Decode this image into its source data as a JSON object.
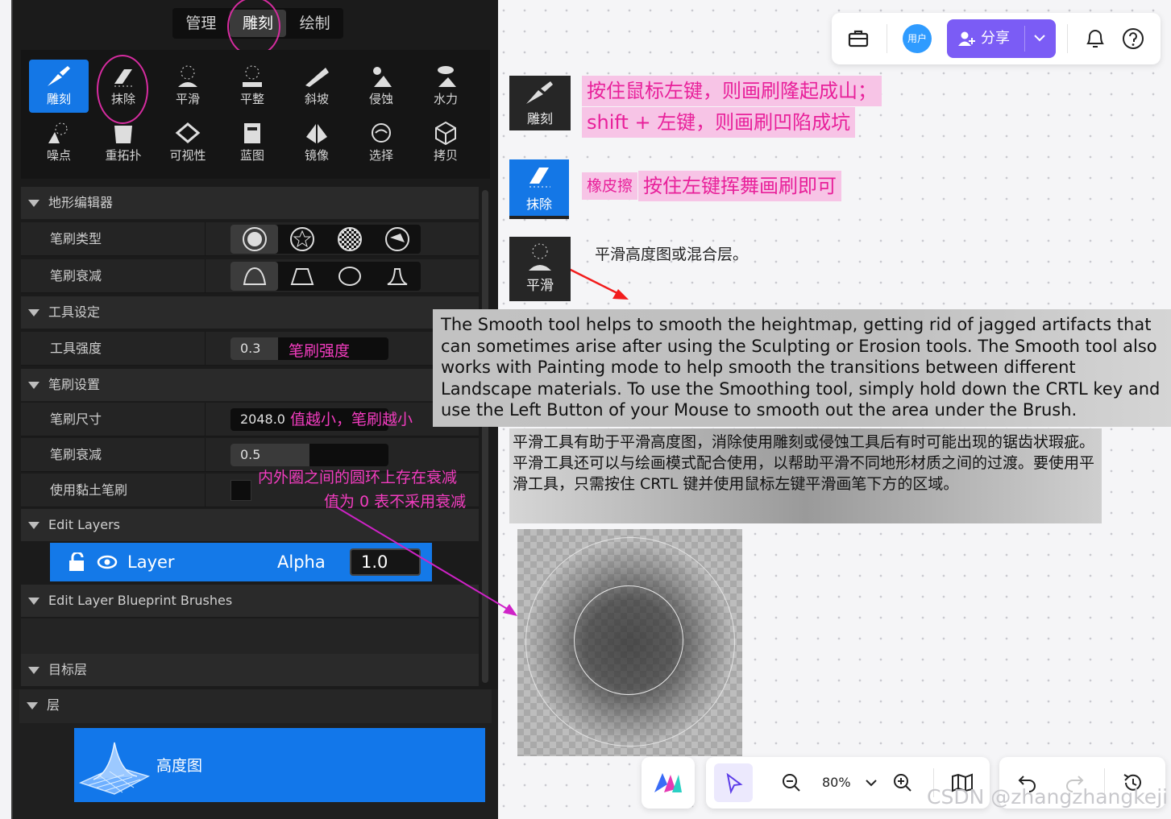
{
  "editor": {
    "modes": [
      "管理",
      "雕刻",
      "绘制"
    ],
    "tools": [
      "雕刻",
      "抹除",
      "平滑",
      "平整",
      "斜坡",
      "侵蚀",
      "水力",
      "噪点",
      "重拓扑",
      "可视性",
      "蓝图",
      "镜像",
      "选择",
      "拷贝"
    ],
    "sections": {
      "terrain_editor": "地形编辑器",
      "tool_settings": "工具设定",
      "brush_settings": "笔刷设置",
      "edit_layers": "Edit Layers",
      "edit_layer_bp": "Edit Layer Blueprint Brushes",
      "target_layer": "目标层",
      "layers": "层"
    },
    "rows": {
      "brush_type": "笔刷类型",
      "brush_falloff": "笔刷衰减",
      "tool_strength": "工具强度",
      "tool_strength_value": "0.3",
      "brush_size": "笔刷尺寸",
      "brush_size_value": "2048.0",
      "brush_falloff2": "笔刷衰减",
      "brush_falloff_value": "0.5",
      "clay_brush": "使用黏土笔刷"
    },
    "tool_strength_fill": 0.3,
    "brush_falloff_fill": 0.5,
    "layer": {
      "name": "Layer",
      "alpha_label": "Alpha",
      "alpha_value": "1.0"
    },
    "heightmap_label": "高度图"
  },
  "annotations": {
    "strength": "笔刷强度",
    "size": "值越小，笔刷越小",
    "falloff_1": "内外圈之间的圆环上存在衰减",
    "falloff_2": "值为 0 表不采用衰减"
  },
  "toolbar": {
    "avatar": "用户",
    "share": "分享"
  },
  "notes": {
    "sculpt_label": "雕刻",
    "sculpt_line1": "按住鼠标左键，则画刷隆起成山；",
    "sculpt_line2": "shift + 左键，则画刷凹陷成坑",
    "erase_label": "抹除",
    "erase_tag": "橡皮擦",
    "erase_text": "按住左键挥舞画刷即可",
    "smooth_label": "平滑",
    "smooth_text": "平滑高度图或混合层。",
    "english": "The Smooth tool helps to smooth the heightmap, getting rid of jagged artifacts that can sometimes arise after using the Sculpting or Erosion tools. The Smooth tool also works with Painting mode to help smooth the transitions between different Landscape materials. To use the Smoothing tool, simply hold down the CRTL key and use the Left Button of your Mouse to smooth out the area under the Brush.",
    "chinese": "平滑工具有助于平滑高度图，消除使用雕刻或侵蚀工具后有时可能出现的锯齿状瑕疵。平滑工具还可以与绘画模式配合使用，以帮助平滑不同地形材质之间的过渡。要使用平滑工具，只需按住 CRTL 键并使用鼠标左键平滑画笔下方的区域。"
  },
  "bottom": {
    "zoom": "80%"
  },
  "watermark": "CSDN @zhangzhangkeji",
  "colors": {
    "accent": "#7b5cf5",
    "ue_blue": "#1479e8",
    "annotation": "#f23cbf",
    "arrow_red": "#f21c1c"
  }
}
